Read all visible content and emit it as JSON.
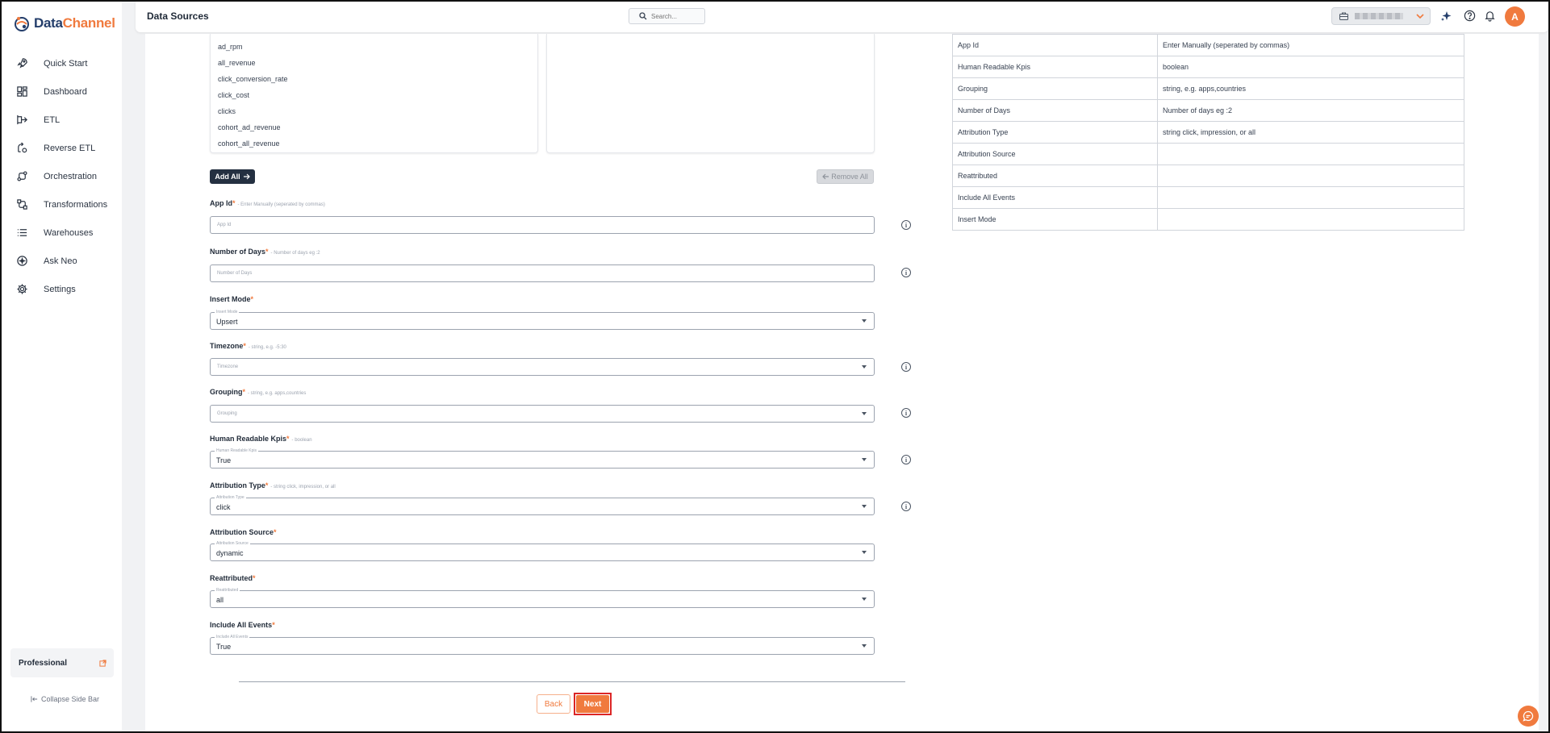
{
  "app": {
    "logo_part1": "Data",
    "logo_part2": "Channel",
    "page_title": "Data Sources"
  },
  "colors": {
    "accent": "#f07a3e",
    "dark": "#243041",
    "highlight_border": "#dc2626"
  },
  "search": {
    "placeholder": "Search..."
  },
  "header": {
    "avatar_initial": "A"
  },
  "sidebar": {
    "items": [
      {
        "label": "Quick Start",
        "icon": "rocket-icon"
      },
      {
        "label": "Dashboard",
        "icon": "dashboard-icon"
      },
      {
        "label": "ETL",
        "icon": "etl-icon"
      },
      {
        "label": "Reverse ETL",
        "icon": "reverse-etl-icon"
      },
      {
        "label": "Orchestration",
        "icon": "orchestration-icon"
      },
      {
        "label": "Transformations",
        "icon": "transformations-icon"
      },
      {
        "label": "Warehouses",
        "icon": "warehouses-icon"
      },
      {
        "label": "Ask Neo",
        "icon": "ask-neo-icon"
      },
      {
        "label": "Settings",
        "icon": "gear-icon"
      }
    ],
    "plan_label": "Professional",
    "collapse_label": "Collapse Side Bar"
  },
  "available_fields": [
    "ad_rpm",
    "all_revenue",
    "click_conversion_rate",
    "click_cost",
    "clicks",
    "cohort_ad_revenue",
    "cohort_all_revenue"
  ],
  "actions": {
    "add_all": "Add All",
    "remove_all": "Remove All",
    "back": "Back",
    "next": "Next"
  },
  "form": {
    "app_id": {
      "label": "App Id",
      "hint": "- Enter Manually (seperated by commas)",
      "placeholder": "App Id"
    },
    "number_of_days": {
      "label": "Number of Days",
      "hint": "- Number of days eg :2",
      "placeholder": "Number of Days"
    },
    "insert_mode": {
      "label": "Insert Mode",
      "float": "Insert Mode",
      "value": "Upsert"
    },
    "timezone": {
      "label": "Timezone",
      "hint": "- string, e.g. -5:30",
      "placeholder": "Timezone"
    },
    "grouping": {
      "label": "Grouping",
      "hint": "- string, e.g. apps,countries",
      "placeholder": "Grouping"
    },
    "human_readable_kpis": {
      "label": "Human Readable Kpis",
      "hint": "- boolean",
      "float": "Human Readable Kpis",
      "value": "True"
    },
    "attribution_type": {
      "label": "Attribution Type",
      "hint": "- string click, impression, or all",
      "float": "Attribution Type",
      "value": "click"
    },
    "attribution_source": {
      "label": "Attribution Source",
      "float": "Attribution Source",
      "value": "dynamic"
    },
    "reattributed": {
      "label": "Reattributed",
      "float": "Reattributed",
      "value": "all"
    },
    "include_all_events": {
      "label": "Include All Events",
      "float": "Include All Events",
      "value": "True"
    }
  },
  "param_table": [
    {
      "name": "App Id",
      "desc": "Enter Manually (seperated by commas)"
    },
    {
      "name": "Human Readable Kpis",
      "desc": "boolean"
    },
    {
      "name": "Grouping",
      "desc": "string, e.g. apps,countries"
    },
    {
      "name": "Number of Days",
      "desc": "Number of days eg :2"
    },
    {
      "name": "Attribution Type",
      "desc": "string click, impression, or all"
    },
    {
      "name": "Attribution Source",
      "desc": ""
    },
    {
      "name": "Reattributed",
      "desc": ""
    },
    {
      "name": "Include All Events",
      "desc": ""
    },
    {
      "name": "Insert Mode",
      "desc": ""
    }
  ]
}
